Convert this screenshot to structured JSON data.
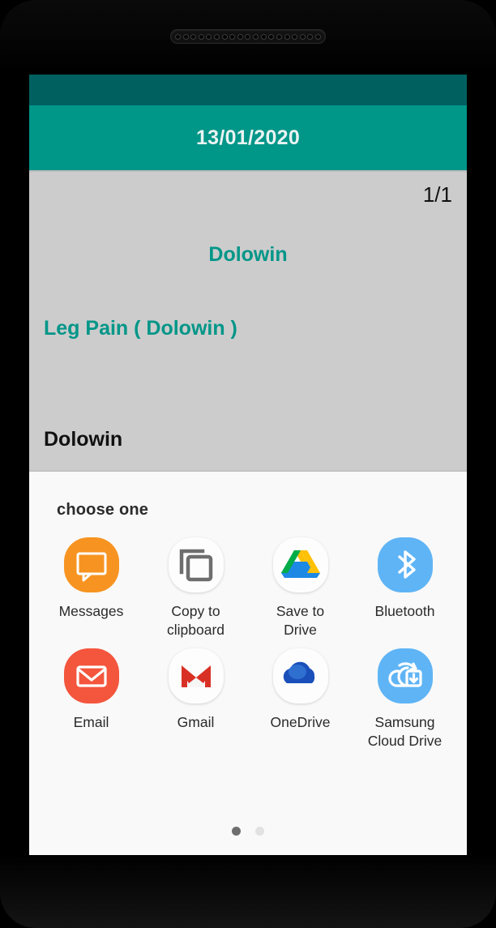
{
  "device": {
    "speaker_holes": 19
  },
  "app": {
    "statusbar_color": "#00605f",
    "accent_color": "#009688",
    "appbar": {
      "title": "13/01/2020"
    },
    "content": {
      "page_count": "1/1",
      "drug_title": "Dolowin",
      "drug_line": "Leg Pain ( Dolowin )",
      "drug_note": "Dolowin",
      "background_color": "#cccccc"
    }
  },
  "share_sheet": {
    "title": "choose one",
    "background_color": "#f9f9f9",
    "items": [
      {
        "label": "Messages",
        "icon": "messages-icon",
        "bg": "#f79421",
        "fg": "#ffffff"
      },
      {
        "label": "Copy to clipboard",
        "icon": "copy-clipboard-icon",
        "bg": "#fdfdfd",
        "fg": "#6e6e6e"
      },
      {
        "label": "Save to Drive",
        "icon": "google-drive-icon",
        "bg": "#fdfdfd",
        "fg": "#00ac47"
      },
      {
        "label": "Bluetooth",
        "icon": "bluetooth-icon",
        "bg": "#5fb4f5",
        "fg": "#ffffff"
      },
      {
        "label": "Email",
        "icon": "email-icon",
        "bg": "#f4553d",
        "fg": "#ffffff"
      },
      {
        "label": "Gmail",
        "icon": "gmail-icon",
        "bg": "#fdfdfd",
        "fg": "#d93025"
      },
      {
        "label": "OneDrive",
        "icon": "onedrive-icon",
        "bg": "#fdfdfd",
        "fg": "#1a4fba"
      },
      {
        "label": "Samsung Cloud Drive",
        "icon": "samsung-cloud-drive-icon",
        "bg": "#5fb4f5",
        "fg": "#ffffff"
      }
    ],
    "pagination": {
      "total": 2,
      "active_index": 0
    }
  }
}
